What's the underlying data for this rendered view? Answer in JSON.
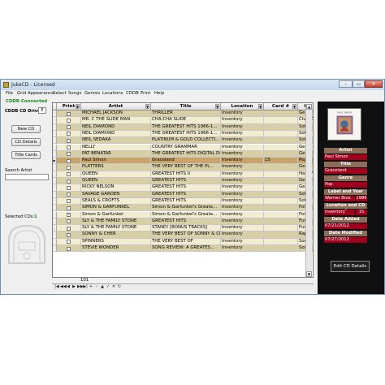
{
  "window": {
    "title": "JukeCD - Licensed",
    "controls": [
      "–",
      "▭",
      "✕"
    ]
  },
  "menu": [
    "File",
    "Grid Appearance",
    "Select",
    "Songs",
    "Genres",
    "Locations",
    "CDDB",
    "Print",
    "Help"
  ],
  "left": {
    "cddb_status": "CDDB Connected",
    "cddb_drive_label": "CDDB CD Drive",
    "cddb_drive_value": "E",
    "new_cd": "New CD",
    "cd_details": "CD Details",
    "title_cards": "Title Cards",
    "search_label": "Search Artist",
    "search_value": "",
    "selected_label": "Selected CDs:",
    "selected_count": "1"
  },
  "grid": {
    "headers": {
      "print": "Print",
      "artist": "Artist",
      "title": "Title",
      "location": "Location",
      "card": "Card #",
      "genre": "G"
    },
    "rows": [
      {
        "print": false,
        "artist": "MICHAEL JACKSON",
        "title": "THRILLER",
        "location": "Inventory",
        "card": "",
        "genre": "Gener"
      },
      {
        "print": false,
        "artist": "MR. C THE SLIDE MAN",
        "title": "CHA-CHA SLIDE",
        "location": "Inventory",
        "card": "",
        "genre": "Club D"
      },
      {
        "print": false,
        "artist": "NEIL DIAMOND",
        "title": "THE GREATEST HITS 1966-1...",
        "location": "Inventory",
        "card": "",
        "genre": "Soft R"
      },
      {
        "print": false,
        "artist": "NEIL DIAMOND",
        "title": "THE GREATEST HITS 1966-1...",
        "location": "Inventory",
        "card": "",
        "genre": "Soft R"
      },
      {
        "print": false,
        "artist": "NEIL SEDAKA",
        "title": "PLATINUM & GOLD COLLECTI...",
        "location": "Inventory",
        "card": "",
        "genre": "Soft R"
      },
      {
        "print": false,
        "artist": "NELLY",
        "title": "COUNTRY GRAMMAR",
        "location": "Inventory",
        "card": "",
        "genre": "Gener"
      },
      {
        "print": false,
        "artist": "PAT BENATAR",
        "title": "THE GREATEST HITS DIGITAL DO...",
        "location": "Inventory",
        "card": "",
        "genre": "Gener"
      },
      {
        "print": false,
        "artist": "Paul Simon",
        "title": "Graceland",
        "location": "Inventory",
        "card": "15",
        "genre": "Pop",
        "current": true
      },
      {
        "print": false,
        "artist": "PLATTERS",
        "title": "THE VERY BEST OF THE PL...",
        "location": "Inventory",
        "card": "",
        "genre": "Gener"
      },
      {
        "print": false,
        "artist": "QUEEN",
        "title": "GREATEST HITS II",
        "location": "Inventory",
        "card": "",
        "genre": "Hard F"
      },
      {
        "print": false,
        "artist": "QUEEN",
        "title": "GREATEST HITS",
        "location": "Inventory",
        "card": "",
        "genre": "Gener"
      },
      {
        "print": false,
        "artist": "RICKY NELSON",
        "title": "GREATEST HITS",
        "location": "Inventory",
        "card": "",
        "genre": "Gener"
      },
      {
        "print": false,
        "artist": "SAVAGE GARDEN",
        "title": "GREATEST HITS",
        "location": "Inventory",
        "card": "",
        "genre": "Soft R"
      },
      {
        "print": false,
        "artist": "SEALS & CROFTS",
        "title": "GREATEST HITS",
        "location": "Inventory",
        "card": "",
        "genre": "Soft R"
      },
      {
        "print": false,
        "artist": "SIMON & GARFUNKEL",
        "title": "Simon & Garfunkel's Greate...",
        "location": "Inventory",
        "card": "",
        "genre": "Folk-R"
      },
      {
        "print": true,
        "artist": "Simon & Garfunkel",
        "title": "Simon & Garfunkel's Greate...",
        "location": "Inventory",
        "card": "",
        "genre": "Folk-R"
      },
      {
        "print": false,
        "artist": "SLY & THE FAMILY STONE",
        "title": "GREATEST HITS",
        "location": "Inventory",
        "card": "",
        "genre": "Funk"
      },
      {
        "print": false,
        "artist": "SLY & THE FAMILY STONE",
        "title": "STAND! [BONUS TRACKS]",
        "location": "Inventory",
        "card": "",
        "genre": "Funk"
      },
      {
        "print": false,
        "artist": "SONNY & CHER",
        "title": "THE VERY BEST OF SONNY & CHER",
        "location": "Inventory",
        "card": "",
        "genre": "Rap &"
      },
      {
        "print": false,
        "artist": "SPINNERS",
        "title": "THE VERY BEST OF",
        "location": "Inventory",
        "card": "",
        "genre": "Soul"
      },
      {
        "print": false,
        "artist": "STEVIE WONDER",
        "title": "SONG REVIEW: A GREATES...",
        "location": "Inventory",
        "card": "",
        "genre": "Soul"
      }
    ],
    "new_row_number": "101"
  },
  "navbar": [
    "|◀",
    "◀◀",
    "◀",
    "▶",
    "▶▶",
    "▶|",
    "+",
    "–",
    "▲",
    "✓",
    "✕",
    "↻"
  ],
  "details": {
    "artist_label": "Artist",
    "artist": "Paul Simon",
    "title_label": "Title",
    "title": "Graceland",
    "genre_label": "Genre",
    "genre": "Pop",
    "label_year_label": "Label and Year",
    "label": "Warner Bros",
    "year": "1986",
    "location_label": "Location and CD #",
    "location": "Inventory",
    "cd_number": "15",
    "date_added_label": "Date Added",
    "date_added": "07/21/2012",
    "date_modified_label": "Date Modified",
    "date_modified": "07/27/2012",
    "edit_button": "Edit CD Details"
  },
  "colors": {
    "row_tan": "#d9cfa6",
    "row_light": "#f2ecd2",
    "row_current": "#c8a46a",
    "label_bg": "#8a6e5a",
    "value_bg": "#a0001c",
    "panel_bg": "#101010"
  },
  "icons": {
    "app": "jukebox-app-icon",
    "jukebox": "jukebox-watermark-icon",
    "cover": "album-cover-image"
  }
}
